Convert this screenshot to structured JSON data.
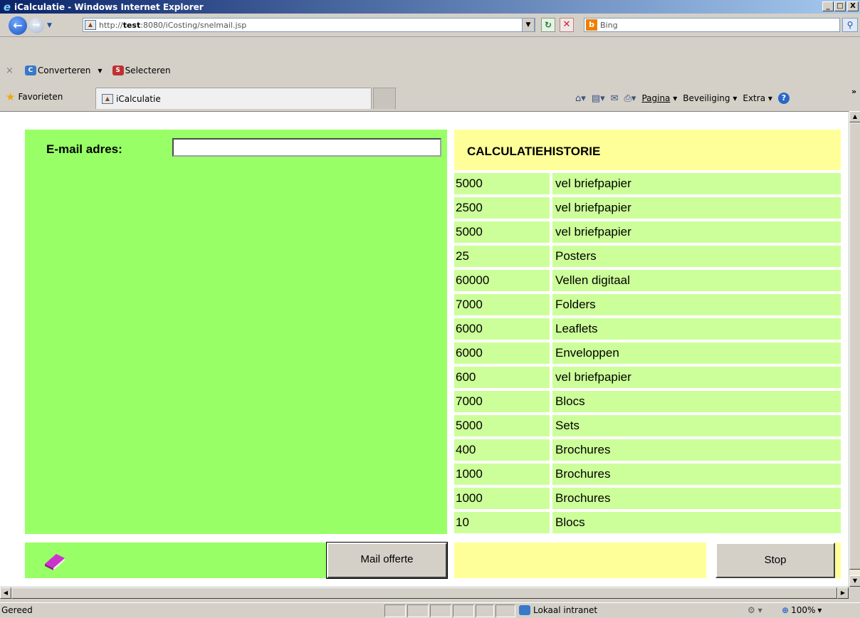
{
  "window": {
    "title": "iCalculatie - Windows Internet Explorer",
    "minimize": "_",
    "maximize": "□",
    "close": "X"
  },
  "address": {
    "url_prefix": "http://",
    "url_host": "test",
    "url_rest": ":8080/iCosting/snelmail.jsp",
    "search_placeholder": "Bing"
  },
  "command_bar": {
    "converteren": "Converteren",
    "selecteren": "Selecteren"
  },
  "favorites_bar": {
    "favorites": "Favorieten",
    "tab_title": "iCalculatie",
    "pagina": "Pagina",
    "beveiliging": "Beveiliging",
    "extra": "Extra"
  },
  "page": {
    "email_label": "E-mail adres:",
    "email_value": "",
    "history_title": "CALCULATIEHISTORIE",
    "history": [
      {
        "qty": "5000",
        "desc": "vel briefpapier"
      },
      {
        "qty": "2500",
        "desc": "vel briefpapier"
      },
      {
        "qty": "5000",
        "desc": "vel briefpapier"
      },
      {
        "qty": "25",
        "desc": "Posters"
      },
      {
        "qty": "60000",
        "desc": "Vellen digitaal"
      },
      {
        "qty": "7000",
        "desc": "Folders"
      },
      {
        "qty": "6000",
        "desc": "Leaflets"
      },
      {
        "qty": "6000",
        "desc": "Enveloppen"
      },
      {
        "qty": "600",
        "desc": "vel briefpapier"
      },
      {
        "qty": "7000",
        "desc": "Blocs"
      },
      {
        "qty": "5000",
        "desc": "Sets"
      },
      {
        "qty": "400",
        "desc": "Brochures"
      },
      {
        "qty": "1000",
        "desc": "Brochures"
      },
      {
        "qty": "1000",
        "desc": "Brochures"
      },
      {
        "qty": "10",
        "desc": "Blocs"
      }
    ],
    "mail_button": "Mail offerte",
    "stop_button": "Stop"
  },
  "status_bar": {
    "status": "Gereed",
    "zone": "Lokaal intranet",
    "zoom": "100%"
  },
  "colors": {
    "left_panel": "#99ff66",
    "history_header": "#ffff99",
    "history_row": "#ccff99"
  }
}
